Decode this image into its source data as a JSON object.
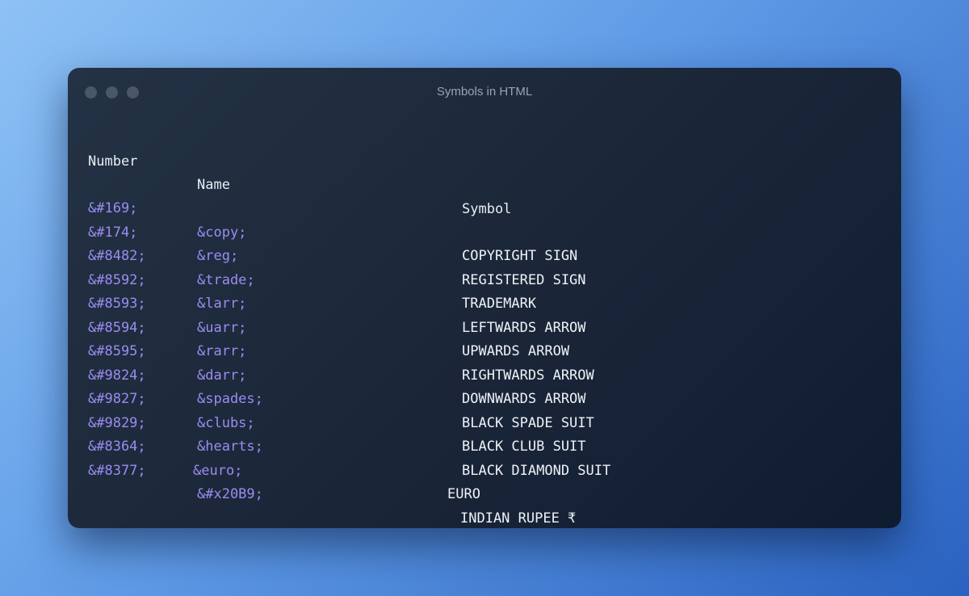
{
  "window": {
    "title": "Symbols in HTML"
  },
  "table": {
    "headers": {
      "number": "Number",
      "name": "Name",
      "symbol": "Symbol"
    },
    "rows": [
      {
        "number": "&#169;",
        "name": "&copy;",
        "symbol": "COPYRIGHT SIGN"
      },
      {
        "number": "&#174;",
        "name": "&reg;",
        "symbol": "REGISTERED SIGN"
      },
      {
        "number": "&#8482;",
        "name": "&trade;",
        "symbol": "TRADEMARK"
      },
      {
        "number": "&#8592;",
        "name": "&larr;",
        "symbol": "LEFTWARDS ARROW"
      },
      {
        "number": "&#8593;",
        "name": "&uarr;",
        "symbol": "UPWARDS ARROW"
      },
      {
        "number": "&#8594;",
        "name": "&rarr;",
        "symbol": "RIGHTWARDS ARROW"
      },
      {
        "number": "&#8595;",
        "name": "&darr;",
        "symbol": "DOWNWARDS ARROW"
      },
      {
        "number": "&#9824;",
        "name": "&spades;",
        "symbol": "BLACK SPADE SUIT"
      },
      {
        "number": "&#9827;",
        "name": "&clubs;",
        "symbol": "BLACK CLUB SUIT"
      },
      {
        "number": "&#9829;",
        "name": "&hearts;",
        "symbol": "BLACK DIAMOND SUIT"
      },
      {
        "number": "&#8364;",
        "name": "&euro;",
        "symbol": "EURO"
      },
      {
        "number": "&#8377;",
        "name": "&#x20B9;",
        "symbol": "INDIAN RUPEE ₹"
      }
    ]
  },
  "colors": {
    "entity": "#9b8cf2",
    "text": "#eef2f7",
    "window_bg": "#1a2638",
    "traffic_light": "#4b5766"
  }
}
